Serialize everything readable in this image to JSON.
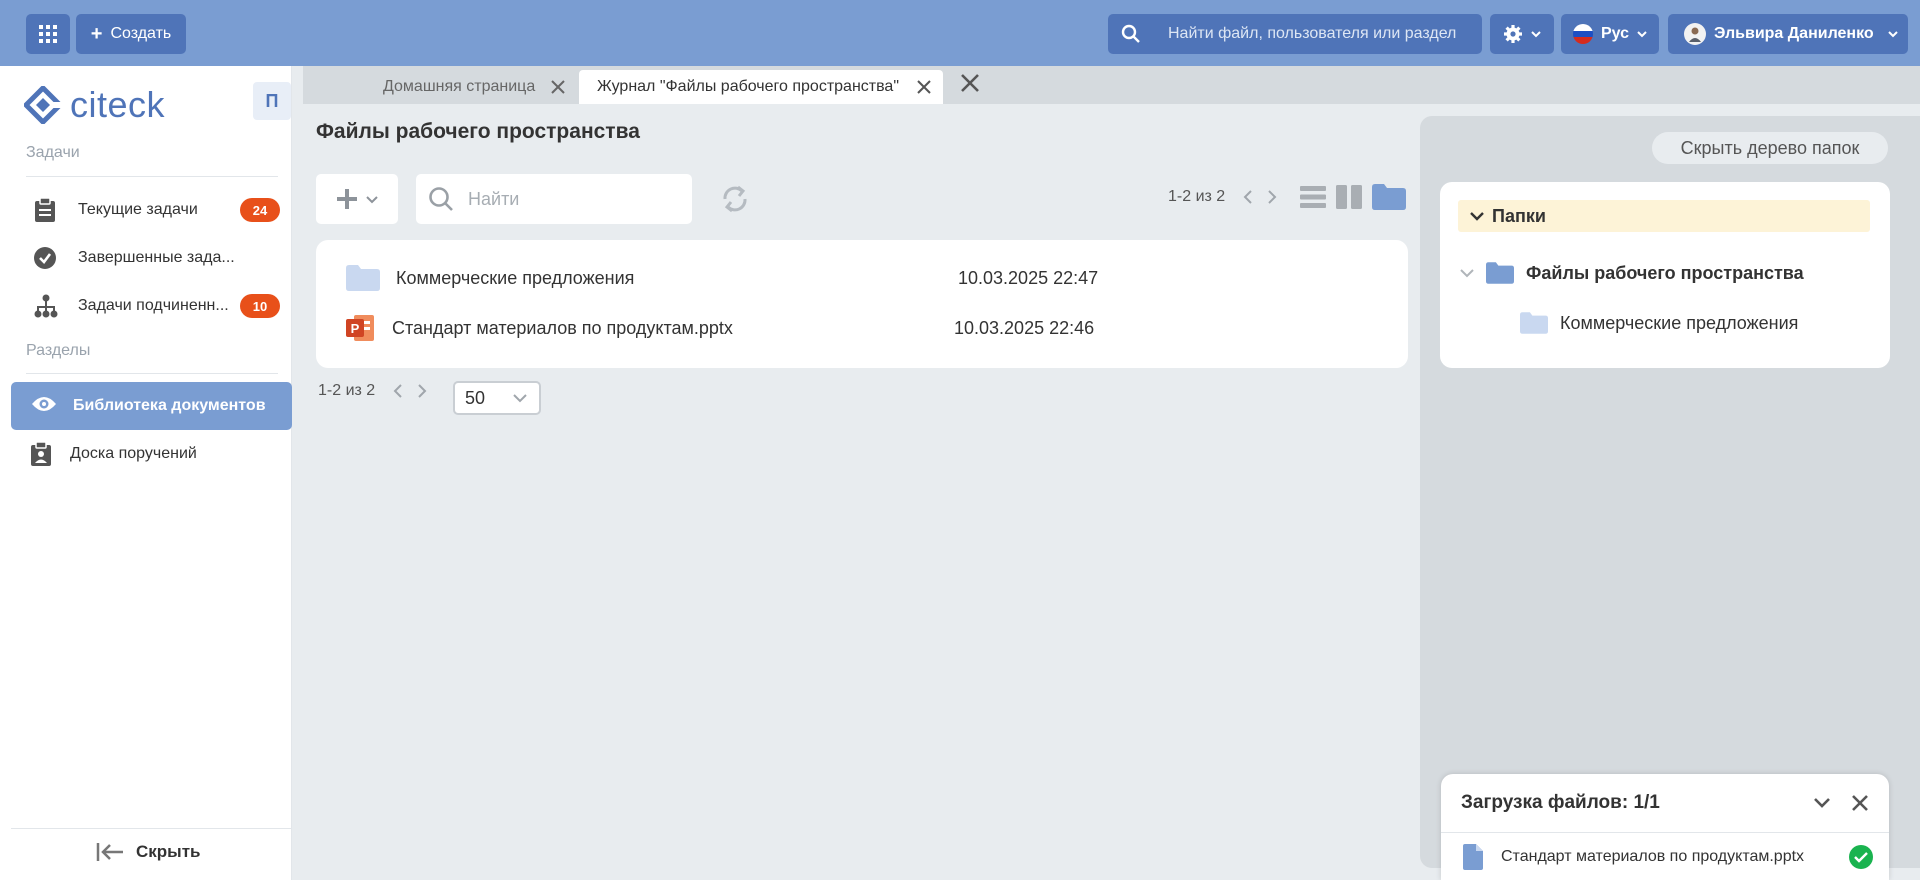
{
  "header": {
    "create_label": "Создать",
    "search_placeholder": "Найти файл, пользователя или раздел",
    "lang_label": "Рус",
    "user_name": "Эльвира Даниленко"
  },
  "sidebar": {
    "logo_text": "citeck",
    "pin_label": "П",
    "tasks_section": "Задачи",
    "tasks": [
      {
        "label": "Текущие задачи",
        "badge": "24",
        "icon": "clipboard-icon"
      },
      {
        "label": "Завершенные зада...",
        "icon": "check-circle-icon"
      },
      {
        "label": "Задачи подчиненн...",
        "badge": "10",
        "icon": "hierarchy-icon"
      }
    ],
    "sections_section": "Разделы",
    "sections": [
      {
        "label": "Библиотека документов",
        "icon": "eye-icon",
        "active": true
      },
      {
        "label": "Доска поручений",
        "icon": "clipboard-user-icon"
      }
    ],
    "hide_label": "Скрыть"
  },
  "tabs": [
    {
      "label": "Домашняя страница",
      "active": false
    },
    {
      "label": "Журнал \"Файлы рабочего пространства\"",
      "active": true
    }
  ],
  "main": {
    "title": "Файлы рабочего пространства",
    "search_placeholder": "Найти",
    "pager_text": "1-2 из 2",
    "per_page": "50",
    "items": [
      {
        "name": "Коммерческие предложения",
        "date": "10.03.2025 22:47",
        "type": "folder"
      },
      {
        "name": "Стандарт материалов по продуктам.pptx",
        "date": "10.03.2025 22:46",
        "type": "pptx"
      }
    ]
  },
  "folder_tree": {
    "hide_button": "Скрыть дерево папок",
    "header": "Папки",
    "root": "Файлы рабочего пространства",
    "child": "Коммерческие предложения"
  },
  "upload": {
    "title": "Загрузка файлов: 1/1",
    "file": "Стандарт материалов по продуктам.pptx"
  },
  "colors": {
    "header_bg": "#7a9dd2",
    "button_bg": "#4f74b8",
    "badge": "#e8501a",
    "success": "#1ab34f",
    "pptx": "#d04423"
  }
}
